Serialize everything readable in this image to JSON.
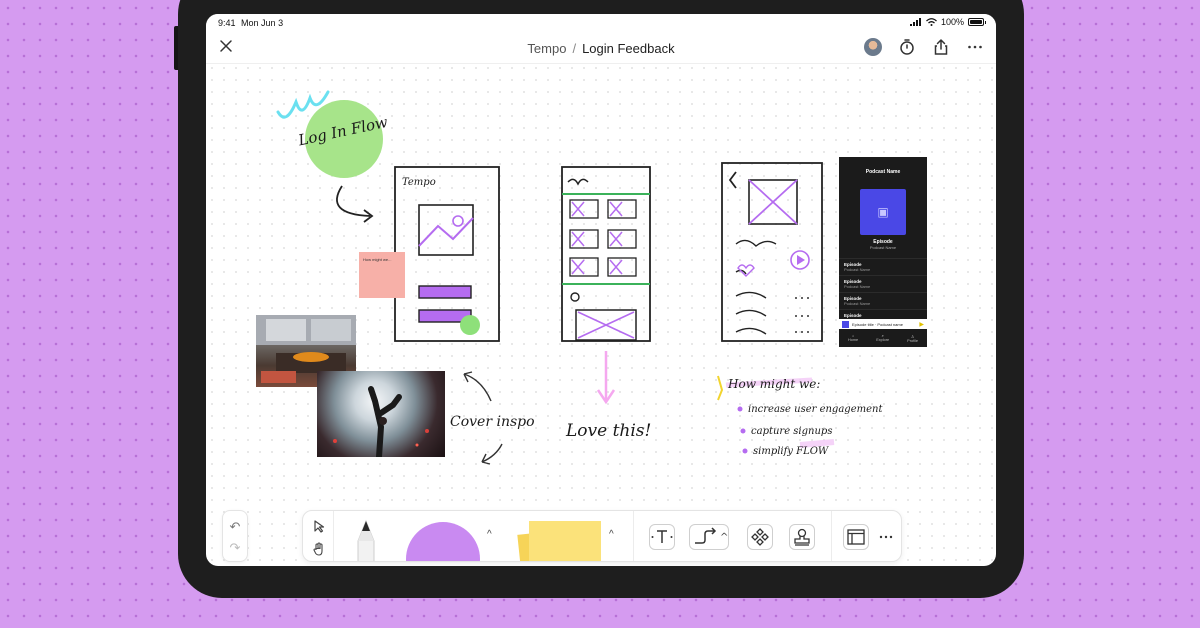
{
  "status_bar": {
    "time": "9:41",
    "date": "Mon Jun 3",
    "battery": "100%"
  },
  "header": {
    "close_icon": "close-icon",
    "breadcrumb_project": "Tempo",
    "breadcrumb_separator": "/",
    "breadcrumb_file": "Login Feedback",
    "actions": [
      "avatar",
      "timer-icon",
      "share-icon",
      "more-icon"
    ]
  },
  "canvas": {
    "sticker_text": "Log In Flow",
    "sketch_title": "Tempo",
    "sticky_note_text": "How might we...",
    "cover_inspo": "Cover inspo",
    "love_this": "Love this!",
    "hmw_title": "How might we:",
    "hmw_items": [
      "increase user engagement",
      "capture signups",
      "simplify FLOW"
    ],
    "podcast_mock": {
      "title": "Podcast Name",
      "episode_title": "Episode",
      "episode_sub": "Podcast Name",
      "rows": [
        {
          "title": "Episode",
          "sub": "Podcast Name"
        },
        {
          "title": "Episode",
          "sub": "Podcast Name"
        },
        {
          "title": "Episode",
          "sub": "Podcast Name"
        },
        {
          "title": "Episode",
          "sub": "Podcast Name"
        }
      ],
      "player_title": "Episode title",
      "player_sub": "Podcast name",
      "tabs": [
        "Home",
        "Explore",
        "Profile"
      ]
    }
  },
  "colors": {
    "background": "#d59bf0",
    "sticker_green": "#a7e48a",
    "purple_tool": "#c98af1",
    "sticky_yellow": "#fbe27a",
    "highlight_purple": "#b56cf0",
    "pink_arrow": "#f5a8ef",
    "sticky_pink": "#f7b0a8",
    "podcast_art": "#4a48e6"
  },
  "toolbar": {
    "left": [
      "undo-icon",
      "redo-icon"
    ],
    "tools": [
      "select-icon",
      "hand-icon",
      "pen-tool",
      "shape-tool",
      "sticky-tool",
      "text-icon",
      "connector-icon",
      "component-icon",
      "stamp-icon",
      "section-icon",
      "more-icon"
    ]
  }
}
